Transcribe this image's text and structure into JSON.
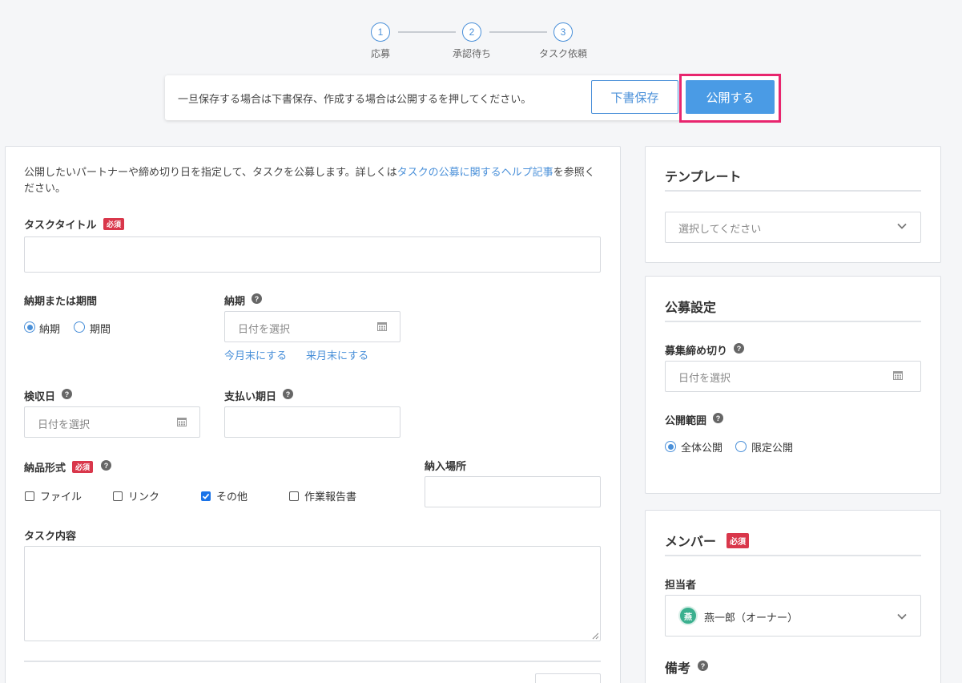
{
  "steps": [
    {
      "num": "1",
      "label": "応募"
    },
    {
      "num": "2",
      "label": "承認待ち"
    },
    {
      "num": "3",
      "label": "タスク依頼"
    }
  ],
  "action_bar": {
    "message": "一旦保存する場合は下書保存、作成する場合は公開するを押してください。",
    "draft_label": "下書保存",
    "publish_label": "公開する"
  },
  "main": {
    "intro_pre": "公開したいパートナーや締め切り日を指定して、タスクを公募します。詳しくは",
    "intro_link": "タスクの公募に関するヘルプ記事",
    "intro_post": "を参照ください。",
    "title_label": "タスクタイトル",
    "required": "必須",
    "deadline_type_label": "納期または期間",
    "radio_deadline": "納期",
    "radio_period": "期間",
    "deadline_label": "納期",
    "date_placeholder": "日付を選択",
    "end_this_month": "今月末にする",
    "end_next_month": "来月末にする",
    "inspection_label": "検収日",
    "payment_label": "支払い期日",
    "delivery_format_label": "納品形式",
    "formats": [
      "ファイル",
      "リンク",
      "その他",
      "作業報告書"
    ],
    "delivery_place_label": "納入場所",
    "content_label": "タスク内容"
  },
  "sidebar": {
    "template_title": "テンプレート",
    "template_placeholder": "選択してください",
    "recruit_title": "公募設定",
    "recruit_deadline_label": "募集締め切り",
    "date_placeholder": "日付を選択",
    "scope_label": "公開範囲",
    "scope_all": "全体公開",
    "scope_limited": "限定公開",
    "member_title": "メンバー",
    "required": "必須",
    "assignee_label": "担当者",
    "assignee_avatar": "燕",
    "assignee_name": "燕一郎（オーナー）",
    "notes_title": "備考"
  },
  "colors": {
    "accent": "#4a90d9",
    "required": "#d9374b",
    "highlight": "#e8256e",
    "avatar": "#3bb08f"
  }
}
